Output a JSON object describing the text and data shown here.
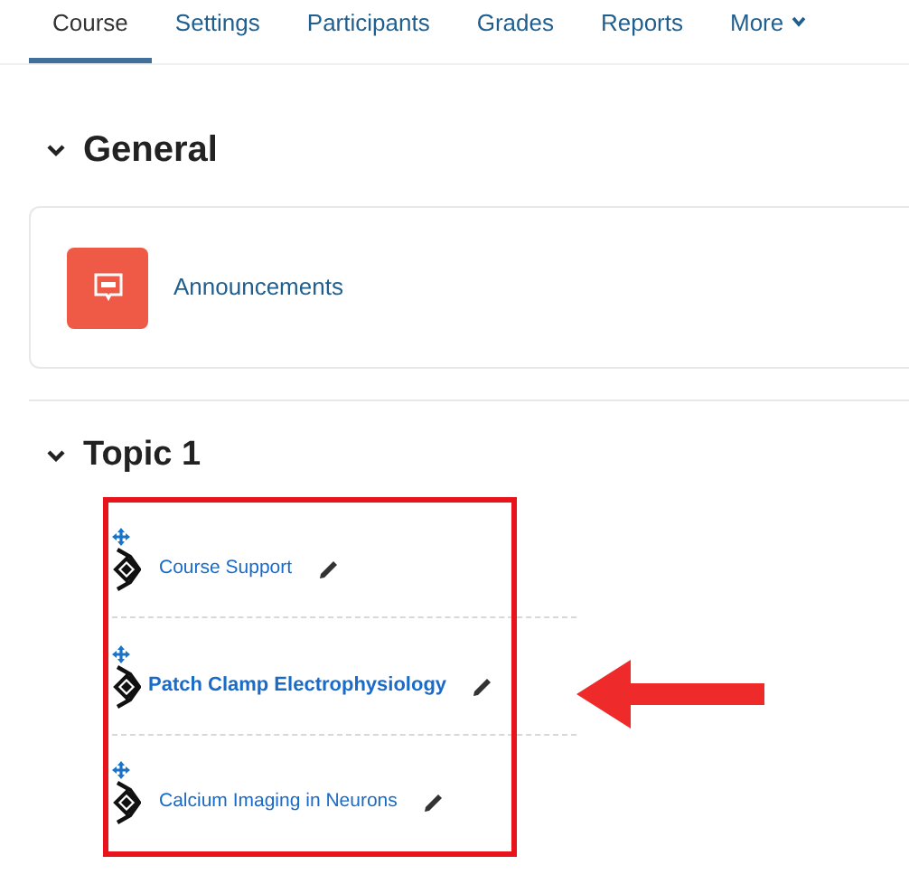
{
  "tabs": [
    {
      "label": "Course",
      "selected": true
    },
    {
      "label": "Settings",
      "selected": false
    },
    {
      "label": "Participants",
      "selected": false
    },
    {
      "label": "Grades",
      "selected": false
    },
    {
      "label": "Reports",
      "selected": false
    },
    {
      "label": "More",
      "selected": false,
      "dropdown": true
    }
  ],
  "general": {
    "title": "General",
    "expanded": true,
    "activities": [
      {
        "label": "Announcements"
      }
    ]
  },
  "topic": {
    "title": "Topic 1",
    "expanded": true,
    "activities": [
      {
        "label": "Course Support",
        "bold": false
      },
      {
        "label": "Patch Clamp Electrophysiology",
        "bold": true
      },
      {
        "label": "Calcium Imaging in Neurons",
        "bold": false
      }
    ]
  }
}
